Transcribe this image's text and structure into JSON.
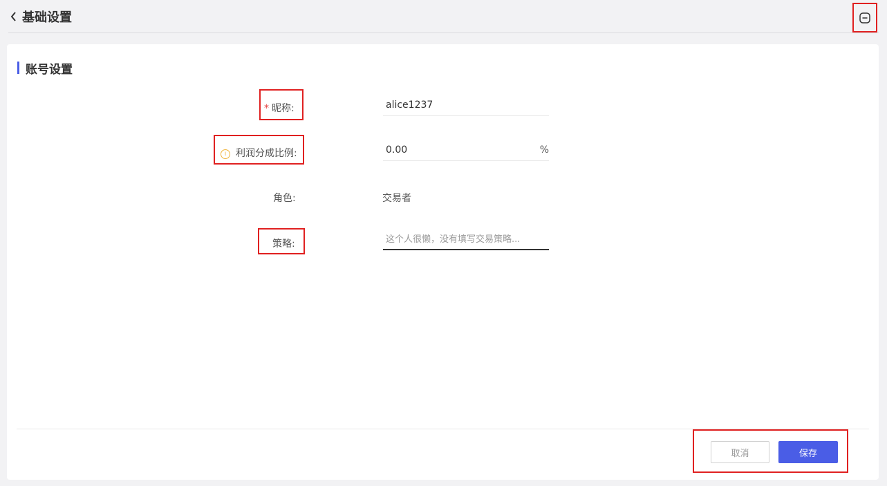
{
  "header": {
    "title": "基础设置"
  },
  "section": {
    "title": "账号设置"
  },
  "form": {
    "nickname": {
      "required_mark": "*",
      "label": "昵称:",
      "value": "alice1237"
    },
    "profit_ratio": {
      "info_mark": "i",
      "label": "利润分成比例:",
      "value": "0.00",
      "unit": "%"
    },
    "role": {
      "label": "角色:",
      "value": "交易者"
    },
    "strategy": {
      "label": "策略:",
      "placeholder": "这个人很懒，没有填写交易策略..."
    }
  },
  "actions": {
    "cancel_label": "取消",
    "save_label": "保存"
  },
  "colors": {
    "accent": "#4a5de6",
    "highlight": "#e02020",
    "required": "#e64545",
    "info": "#f0b43c"
  }
}
